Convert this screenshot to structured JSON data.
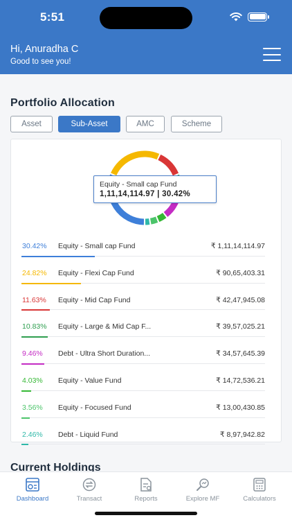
{
  "status_bar": {
    "time": "5:51"
  },
  "header": {
    "greeting": "Hi, Anuradha C",
    "subtitle": "Good to see you!"
  },
  "portfolio": {
    "title": "Portfolio Allocation",
    "tabs": [
      {
        "label": "Asset",
        "active": false
      },
      {
        "label": "Sub-Asset",
        "active": true
      },
      {
        "label": "AMC",
        "active": false
      },
      {
        "label": "Scheme",
        "active": false
      }
    ],
    "tooltip": {
      "label": "Equity - Small cap Fund",
      "value": "1,11,14,114.97 | 30.42%"
    },
    "items": [
      {
        "pct": "30.42%",
        "name": "Equity - Small cap Fund",
        "amount": "₹ 1,11,14,114.97",
        "color": "#3e7fd9",
        "share": 30.42
      },
      {
        "pct": "24.82%",
        "name": "Equity - Flexi Cap Fund",
        "amount": "₹ 90,65,403.31",
        "color": "#f5b800",
        "share": 24.82
      },
      {
        "pct": "11.63%",
        "name": "Equity - Mid Cap Fund",
        "amount": "₹ 42,47,945.08",
        "color": "#d93636",
        "share": 11.63
      },
      {
        "pct": "10.83%",
        "name": "Equity - Large & Mid Cap F...",
        "amount": "₹ 39,57,025.21",
        "color": "#2e9e4f",
        "share": 10.83
      },
      {
        "pct": "9.46%",
        "name": "Debt - Ultra Short Duration...",
        "amount": "₹ 34,57,645.39",
        "color": "#c42cc4",
        "share": 9.46
      },
      {
        "pct": "4.03%",
        "name": "Equity - Value Fund",
        "amount": "₹ 14,72,536.21",
        "color": "#35b835",
        "share": 4.03
      },
      {
        "pct": "3.56%",
        "name": "Equity - Focused Fund",
        "amount": "₹ 13,00,430.85",
        "color": "#4cc46a",
        "share": 3.56
      },
      {
        "pct": "2.46%",
        "name": "Debt - Liquid Fund",
        "amount": "₹ 8,97,942.82",
        "color": "#2fb8a8",
        "share": 2.46
      }
    ]
  },
  "holdings": {
    "title": "Current Holdings"
  },
  "bottom_nav": [
    {
      "label": "Dashboard",
      "icon": "dashboard-icon",
      "active": true
    },
    {
      "label": "Transact",
      "icon": "transact-icon",
      "active": false
    },
    {
      "label": "Reports",
      "icon": "reports-icon",
      "active": false
    },
    {
      "label": "Explore MF",
      "icon": "explore-icon",
      "active": false
    },
    {
      "label": "Calculators",
      "icon": "calculator-icon",
      "active": false
    }
  ],
  "colors": {
    "brand": "#3b78c7",
    "muted": "#8a939c"
  }
}
